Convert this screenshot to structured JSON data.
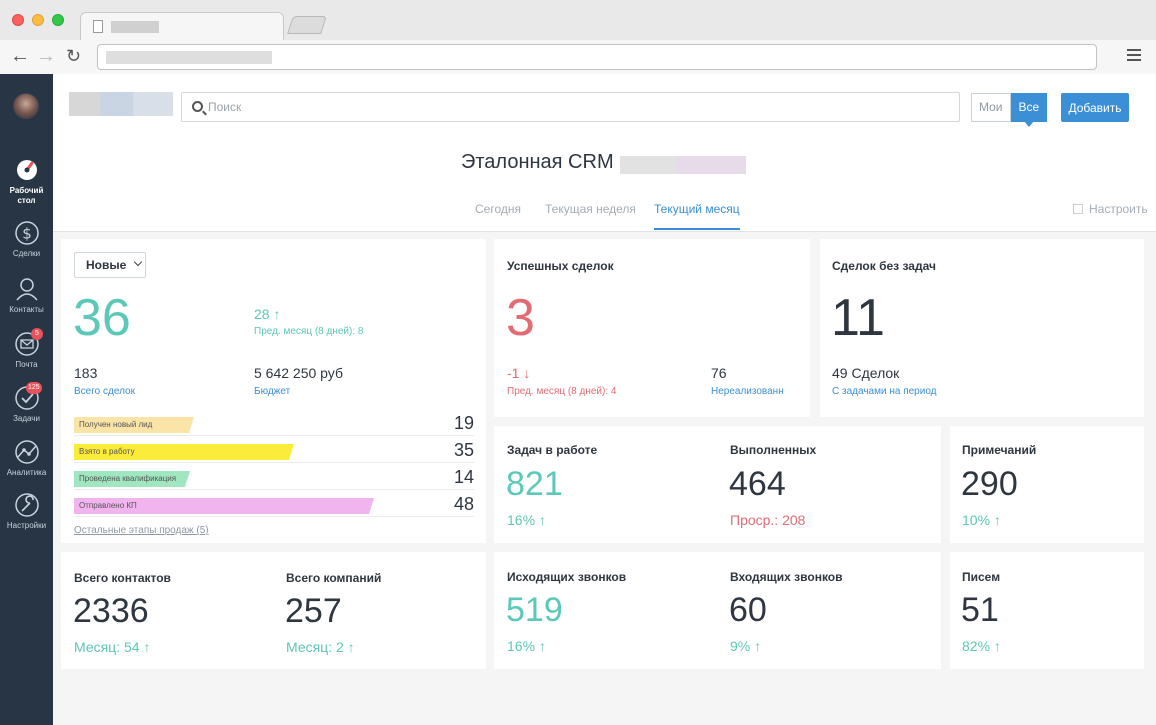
{
  "search": {
    "placeholder": "Поиск"
  },
  "filter": {
    "mine": "Мои",
    "all": "Все"
  },
  "add_button": "Добавить",
  "page_title": "Эталонная CRM",
  "period_tabs": [
    "Сегодня",
    "Текущая неделя",
    "Текущий месяц"
  ],
  "configure": "Настроить",
  "sidebar": {
    "items": [
      {
        "label": "Рабочий стол",
        "icon": "dashboard-icon",
        "active": true
      },
      {
        "label": "Сделки",
        "icon": "dollar-icon"
      },
      {
        "label": "Контакты",
        "icon": "contacts-icon"
      },
      {
        "label": "Почта",
        "icon": "mail-icon",
        "badge": "5"
      },
      {
        "label": "Задачи",
        "icon": "tasks-icon",
        "badge": "125"
      },
      {
        "label": "Аналитика",
        "icon": "analytics-icon"
      },
      {
        "label": "Настройки",
        "icon": "settings-icon"
      }
    ]
  },
  "leads": {
    "dropdown": "Новые",
    "count": "36",
    "delta": "28 ↑",
    "prev_month": "Пред. месяц (8 дней): 8",
    "total_deals": "183",
    "total_deals_label": "Всего сделок",
    "budget": "5 642 250 руб",
    "budget_label": "Бюджет",
    "stages": [
      {
        "label": "Получен новый лид",
        "count": "19",
        "color": "#fbe4a8",
        "fill": 0.3
      },
      {
        "label": "Взято в работу",
        "count": "35",
        "color": "#fbeb3a",
        "fill": 0.55
      },
      {
        "label": "Проведена квалификация",
        "count": "14",
        "color": "#9fe6c1",
        "fill": 0.29
      },
      {
        "label": "Отправлено КП",
        "count": "48",
        "color": "#f2b4ef",
        "fill": 0.75
      }
    ],
    "other_stages": "Остальные этапы продаж (5)"
  },
  "success": {
    "label": "Успешных сделок",
    "count": "3",
    "delta": "-1 ↓",
    "prev_month": "Пред. месяц (8 дней): 4",
    "unrealized": "76",
    "unrealized_label": "Нереализованн"
  },
  "no_tasks": {
    "label": "Сделок без задач",
    "count": "11",
    "deals": "49 Сделок",
    "deals_label": "С задачами на период"
  },
  "tasks": {
    "label": "Задач в работе",
    "value": "821",
    "delta": "16% ↑"
  },
  "done": {
    "label": "Выполненных",
    "value": "464",
    "overdue": "Проср.: 208"
  },
  "notes": {
    "label": "Примечаний",
    "value": "290",
    "delta": "10% ↑"
  },
  "contacts": {
    "label": "Всего контактов",
    "value": "2336",
    "delta": "Месяц: 54 ↑",
    "companies_label": "Всего компаний",
    "companies_value": "257",
    "companies_delta": "Месяц: 2 ↑"
  },
  "outgoing": {
    "label": "Исходящих звонков",
    "value": "519",
    "delta": "16% ↑"
  },
  "incoming": {
    "label": "Входящих звонков",
    "value": "60",
    "delta": "9% ↑"
  },
  "letters": {
    "label": "Писем",
    "value": "51",
    "delta": "82% ↑"
  },
  "colors": {
    "accent": "#3a8fd6",
    "teal": "#5cc8b8",
    "red": "#e36c74",
    "sidebar": "#273544"
  }
}
